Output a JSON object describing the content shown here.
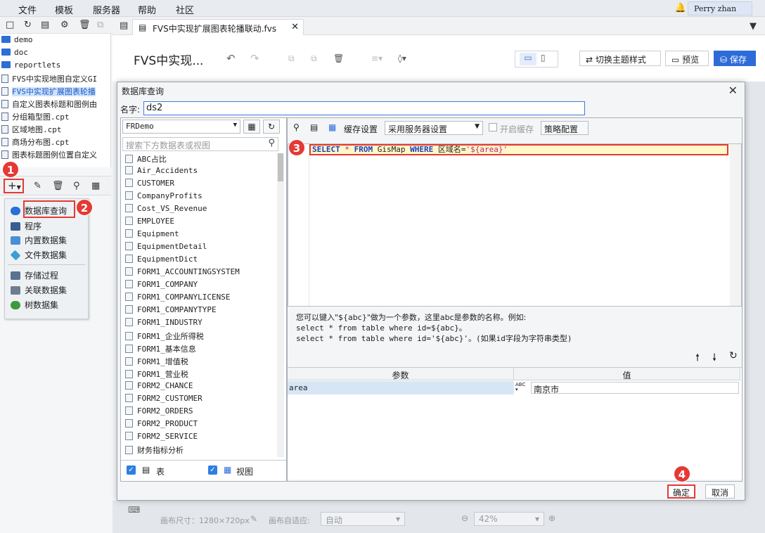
{
  "menu": [
    "文件",
    "模板",
    "服务器",
    "帮助",
    "社区"
  ],
  "user": "Perry zhan",
  "tree": {
    "items": [
      {
        "label": "demo",
        "type": "folder"
      },
      {
        "label": "doc",
        "type": "folder"
      },
      {
        "label": "reportlets",
        "type": "folder"
      },
      {
        "label": "FVS中实现地图自定义GI",
        "type": "file"
      },
      {
        "label": "FVS中实现扩展图表轮播",
        "type": "file",
        "selected": true
      },
      {
        "label": "自定义图表标题和图例由",
        "type": "file"
      },
      {
        "label": "分组箱型图.cpt",
        "type": "file"
      },
      {
        "label": "区域地图.cpt",
        "type": "file"
      },
      {
        "label": "商场分布图.cpt",
        "type": "file"
      },
      {
        "label": "图表标题图例位置自定义",
        "type": "file"
      }
    ]
  },
  "ds_menu": [
    {
      "label": "数据库查询",
      "icon": "database-icon",
      "color": "#2b6fd6"
    },
    {
      "label": "程序",
      "icon": "program-icon",
      "color": "#3a5d8f"
    },
    {
      "label": "内置数据集",
      "icon": "builtin-dataset-icon",
      "color": "#4a8fd6"
    },
    {
      "label": "文件数据集",
      "icon": "file-dataset-icon",
      "color": "#3c9ed9"
    },
    {
      "label": "存储过程",
      "icon": "stored-procedure-icon",
      "color": "#5a7290"
    },
    {
      "label": "关联数据集",
      "icon": "related-dataset-icon",
      "color": "#6d7d8f"
    },
    {
      "label": "树数据集",
      "icon": "tree-dataset-icon",
      "color": "#3d9a3d"
    }
  ],
  "tab": {
    "title": "FVS中实现扩展图表轮播联动.fvs"
  },
  "page_title": "FVS中实现...",
  "toolbar": {
    "theme_label": "切换主题样式",
    "preview_label": "预览",
    "save_label": "保存"
  },
  "bottom": {
    "canvas_size": "画布尺寸：1280×720px",
    "adapt_label": "画布自适应:",
    "adapt_value": "自动",
    "zoom": "42%"
  },
  "dialog": {
    "title": "数据库查询",
    "name_label": "名字:",
    "name_value": "ds2",
    "connection": "FRDemo",
    "search_placeholder": "搜索下方数据表或视图",
    "tables": [
      "ABC占比",
      "Air_Accidents",
      "CUSTOMER",
      "CompanyProfits",
      "Cost_VS_Revenue",
      "EMPLOYEE",
      "Equipment",
      "EquipmentDetail",
      "EquipmentDict",
      "FORM1_ACCOUNTINGSYSTEM",
      "FORM1_COMPANY",
      "FORM1_COMPANYLICENSE",
      "FORM1_COMPANYTYPE",
      "FORM1_INDUSTRY",
      "FORM1_企业所得税",
      "FORM1_基本信息",
      "FORM1_增值税",
      "FORM1_营业税",
      "FORM2_CHANCE",
      "FORM2_CUSTOMER",
      "FORM2_ORDERS",
      "FORM2_PRODUCT",
      "FORM2_SERVICE",
      "财务指标分析"
    ],
    "show_table_label": "表",
    "show_view_label": "视图",
    "cache_label": "缓存设置",
    "cache_value": "采用服务器设置",
    "enable_cache_label": "开启缓存",
    "strategy_label": "策略配置",
    "sql": {
      "kw1": "SELECT",
      "star": " * ",
      "kw2": "FROM",
      "table": " GisMap ",
      "kw3": "WHERE",
      "cond": " 区域名=",
      "param": "'${area}'"
    },
    "hint": [
      "您可以键入\"${abc}\"做为一个参数，这里abc是参数的名称。例如:",
      "select * from table where id=${abc}。",
      "select * from table where id='${abc}'。(如果id字段为字符串类型)"
    ],
    "param_header": "参数",
    "value_header": "值",
    "param_name": "area",
    "param_value": "南京市",
    "ok_label": "确定",
    "cancel_label": "取消"
  },
  "badges": [
    "1",
    "2",
    "3",
    "4"
  ]
}
